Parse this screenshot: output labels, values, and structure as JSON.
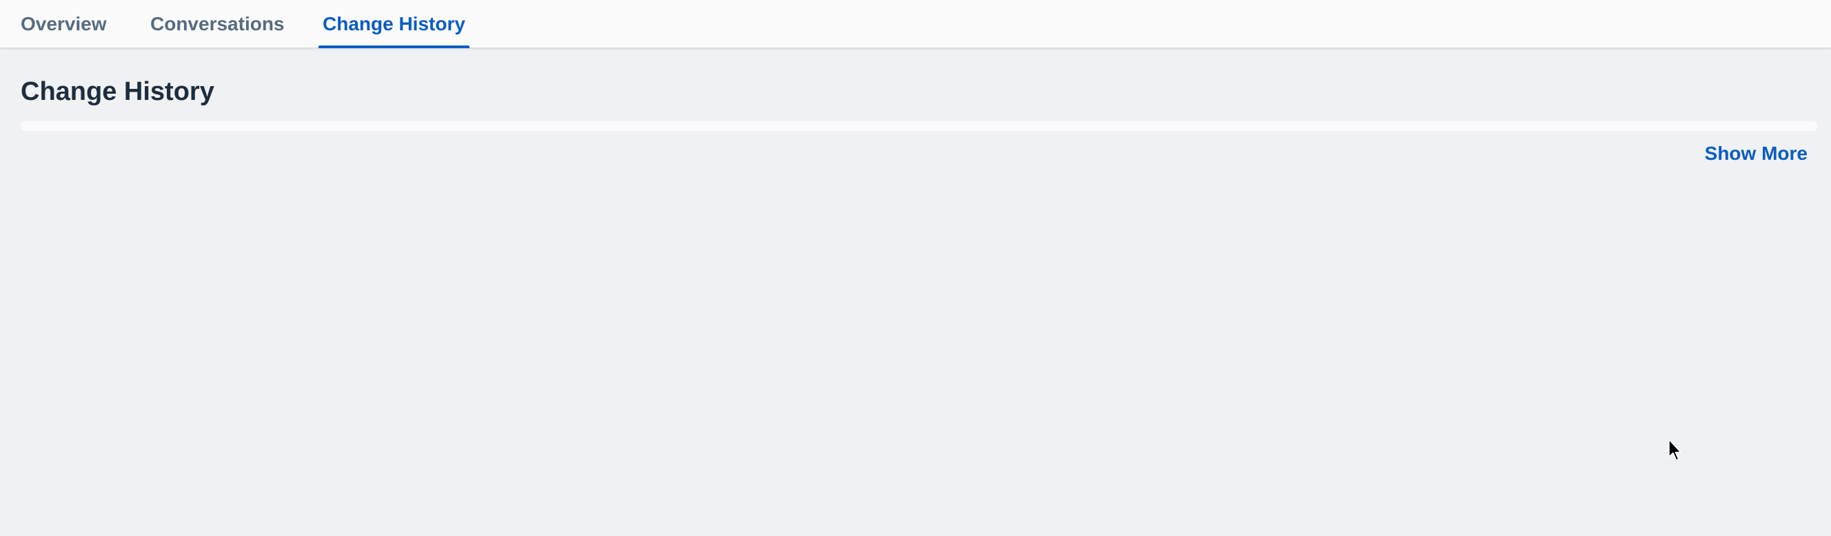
{
  "tabs": [
    {
      "label": "Overview",
      "active": false
    },
    {
      "label": "Conversations",
      "active": false
    },
    {
      "label": "Change History",
      "active": true
    }
  ],
  "section": {
    "title": "Change History"
  },
  "actions": {
    "show_more_label": "Show More"
  },
  "colors": {
    "accent": "#0a5cc3",
    "tab_inactive": "#556b82",
    "title": "#1d2d3e",
    "background": "#eff1f2",
    "tabbar_background": "#fbfbfb"
  },
  "icons": {
    "cursor": "mouse-pointer-icon"
  }
}
